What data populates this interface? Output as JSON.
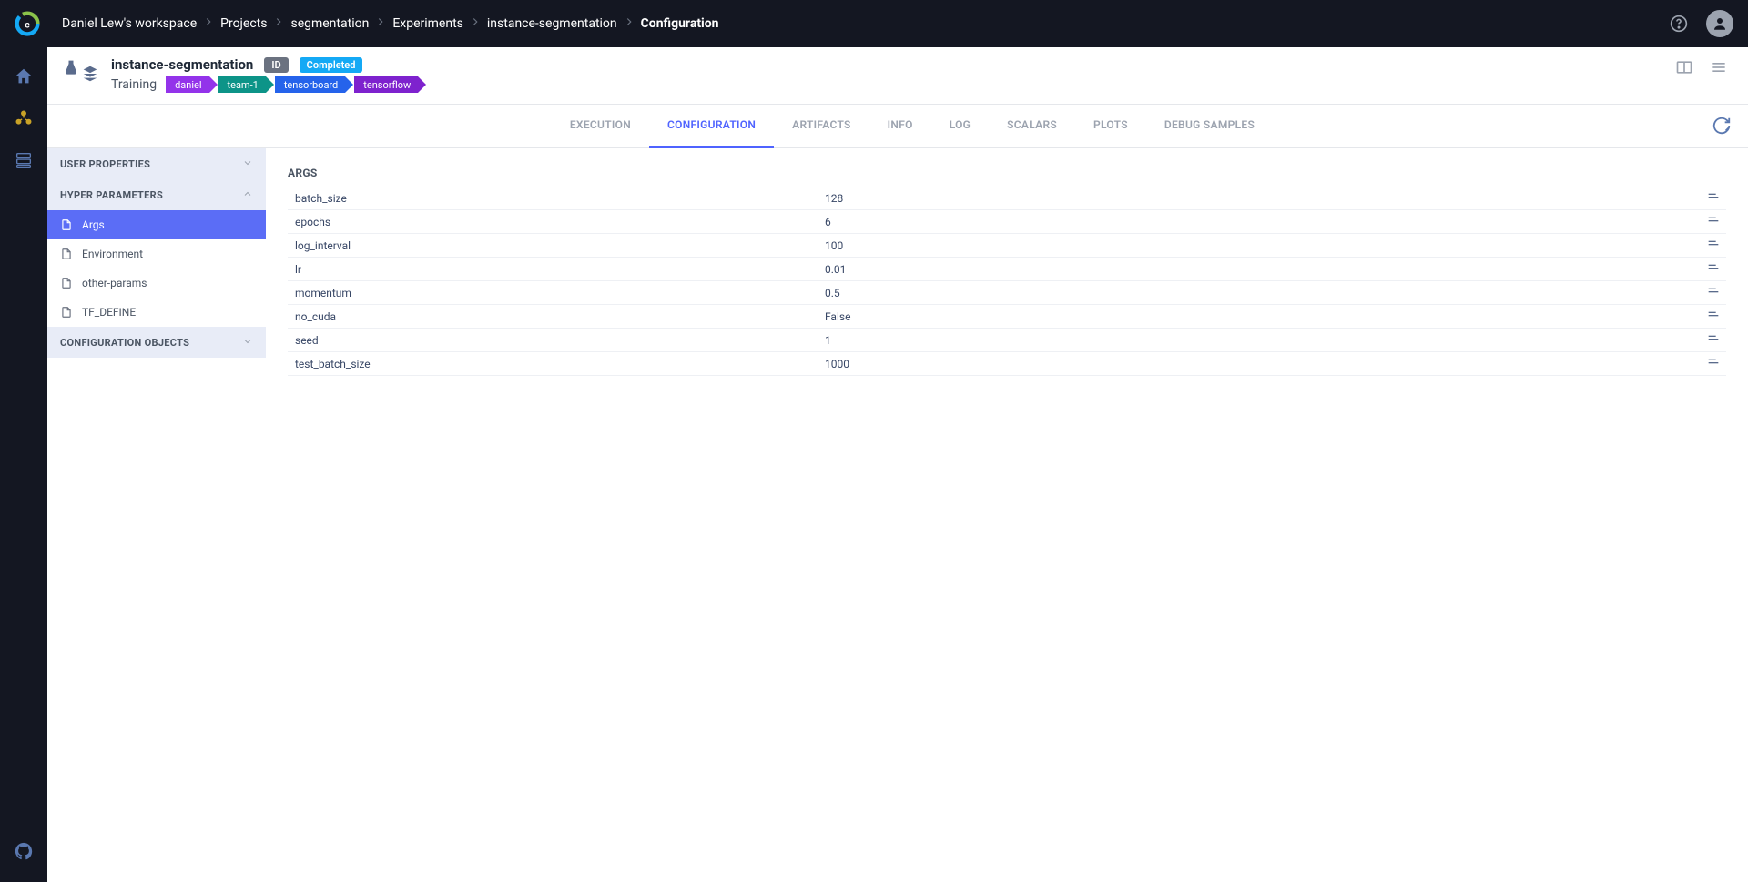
{
  "breadcrumbs": [
    {
      "label": "Daniel Lew's workspace",
      "active": false
    },
    {
      "label": "Projects",
      "active": false
    },
    {
      "label": "segmentation",
      "active": false
    },
    {
      "label": "Experiments",
      "active": false
    },
    {
      "label": "instance-segmentation",
      "active": false
    },
    {
      "label": "Configuration",
      "active": true
    }
  ],
  "experiment": {
    "name": "instance-segmentation",
    "id_badge": "ID",
    "status_badge": "Completed",
    "type": "Training",
    "tags": [
      {
        "label": "daniel",
        "cls": "purple"
      },
      {
        "label": "team-1",
        "cls": "teal"
      },
      {
        "label": "tensorboard",
        "cls": "blue"
      },
      {
        "label": "tensorflow",
        "cls": "dkpurple"
      }
    ]
  },
  "tabs": [
    {
      "label": "EXECUTION",
      "active": false
    },
    {
      "label": "CONFIGURATION",
      "active": true
    },
    {
      "label": "ARTIFACTS",
      "active": false
    },
    {
      "label": "INFO",
      "active": false
    },
    {
      "label": "LOG",
      "active": false
    },
    {
      "label": "SCALARS",
      "active": false
    },
    {
      "label": "PLOTS",
      "active": false
    },
    {
      "label": "DEBUG SAMPLES",
      "active": false
    }
  ],
  "sidepanel": {
    "groups": [
      {
        "label": "USER PROPERTIES",
        "expanded": false,
        "items": []
      },
      {
        "label": "HYPER PARAMETERS",
        "expanded": true,
        "items": [
          {
            "label": "Args",
            "active": true
          },
          {
            "label": "Environment",
            "active": false
          },
          {
            "label": "other-params",
            "active": false
          },
          {
            "label": "TF_DEFINE",
            "active": false
          }
        ]
      },
      {
        "label": "CONFIGURATION OBJECTS",
        "expanded": false,
        "items": []
      }
    ]
  },
  "content": {
    "section_title": "ARGS",
    "params": [
      {
        "key": "batch_size",
        "value": "128"
      },
      {
        "key": "epochs",
        "value": "6"
      },
      {
        "key": "log_interval",
        "value": "100"
      },
      {
        "key": "lr",
        "value": "0.01"
      },
      {
        "key": "momentum",
        "value": "0.5"
      },
      {
        "key": "no_cuda",
        "value": "False"
      },
      {
        "key": "seed",
        "value": "1"
      },
      {
        "key": "test_batch_size",
        "value": "1000"
      }
    ]
  }
}
